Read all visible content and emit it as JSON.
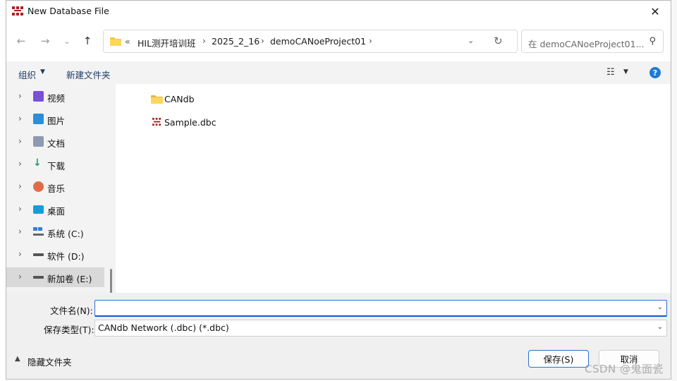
{
  "window": {
    "title": "New Database File"
  },
  "address": {
    "overflow": "«",
    "breadcrumbs": [
      "HIL测开培训班",
      "2025_2_16",
      "demoCANoeProject01"
    ]
  },
  "search": {
    "placeholder": "在 demoCANoeProject01..."
  },
  "toolbar": {
    "organize_label": "组织",
    "new_folder_label": "新建文件夹",
    "help_label": "?"
  },
  "nav": {
    "items": [
      {
        "label": "视频",
        "icon": "video-icon",
        "color": "#7b4fd8"
      },
      {
        "label": "图片",
        "icon": "picture-icon",
        "color": "#2a8fd8"
      },
      {
        "label": "文档",
        "icon": "document-icon",
        "color": "#8c9bb0"
      },
      {
        "label": "下载",
        "icon": "download-icon",
        "color": "#1e9e6a"
      },
      {
        "label": "音乐",
        "icon": "music-icon",
        "color": "#e06b4a"
      },
      {
        "label": "桌面",
        "icon": "desktop-icon",
        "color": "#1a9bd8"
      },
      {
        "label": "系统 (C:)",
        "icon": "drive-c-icon",
        "color": "#3a7bd5"
      },
      {
        "label": "软件 (D:)",
        "icon": "drive-d-icon",
        "color": "#555555"
      },
      {
        "label": "新加卷 (E:)",
        "icon": "drive-e-icon",
        "color": "#555555",
        "selected": true
      }
    ]
  },
  "files": [
    {
      "name": "CANdb",
      "icon": "folder-icon",
      "color": "#f4c542"
    },
    {
      "name": "Sample.dbc",
      "icon": "dbc-file-icon",
      "color": "#b02020"
    }
  ],
  "form": {
    "filename_label": "文件名(N):",
    "filename_value": "",
    "filetype_label": "保存类型(T):",
    "filetype_value": "CANdb Network (.dbc) (*.dbc)"
  },
  "footer": {
    "hide_folders_label": "隐藏文件夹",
    "save_label": "保存(S)",
    "cancel_label": "取消"
  },
  "watermark": "CSDN @鬼面瓷",
  "colors": {
    "accent": "#2b6fd1",
    "help": "#1e7ad6",
    "selected": "#d9d9d9"
  }
}
